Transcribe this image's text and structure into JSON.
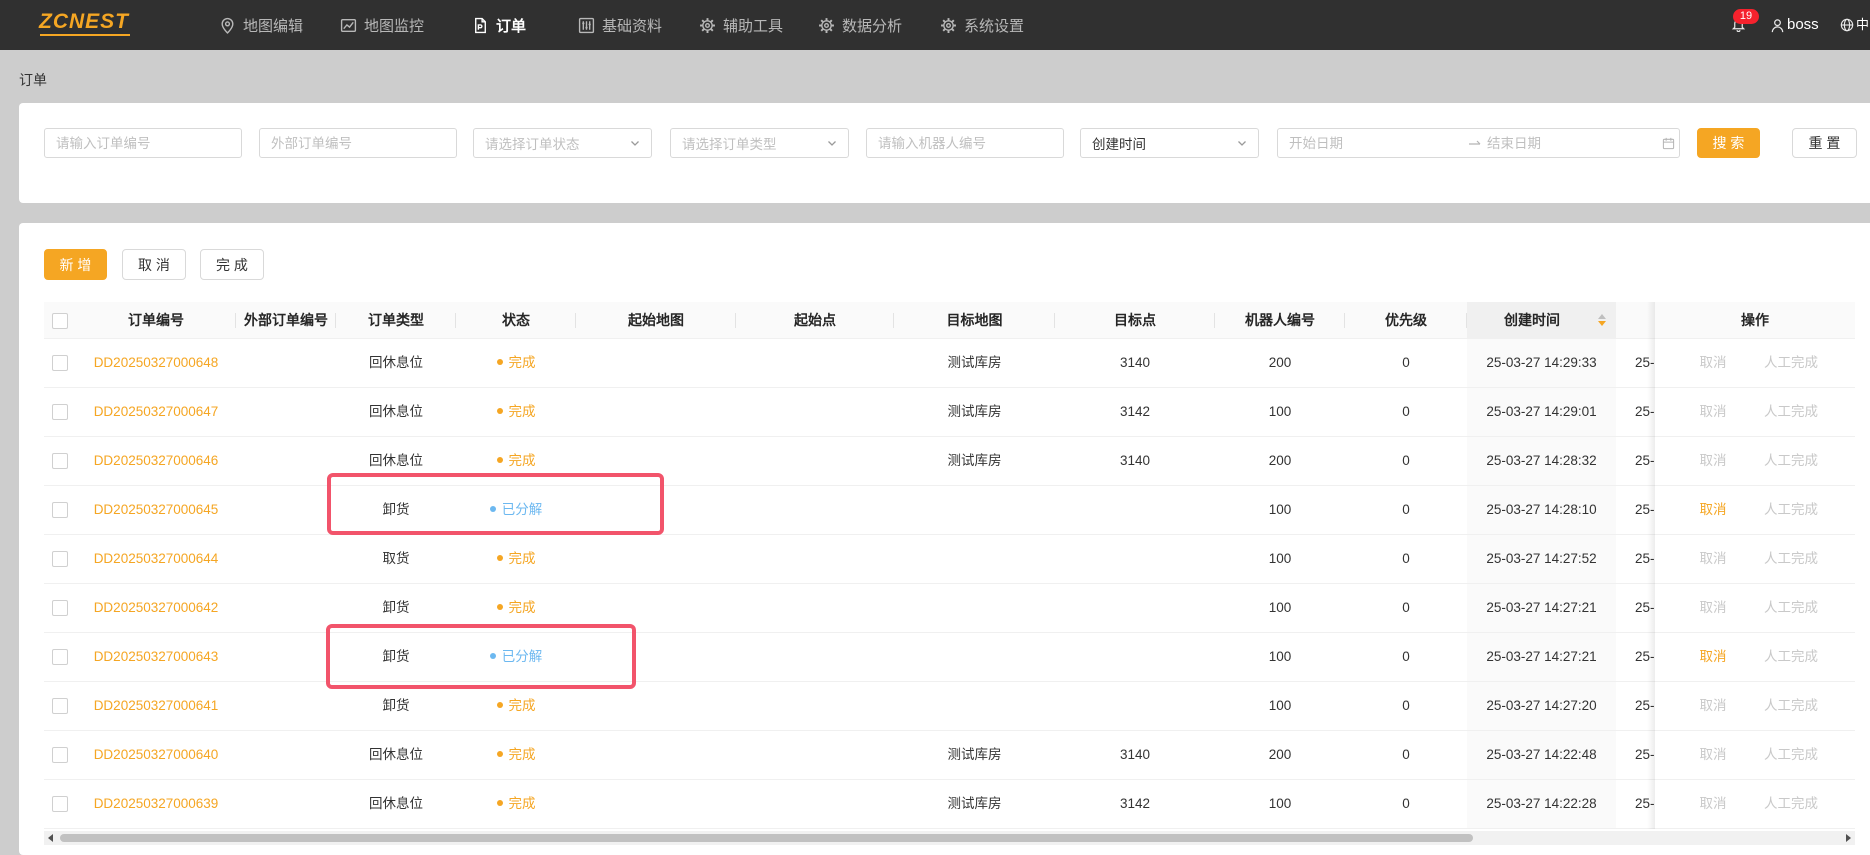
{
  "brand": {
    "logo_text": "ZCNEST",
    "accent_color": "#f5a623"
  },
  "nav": {
    "items": [
      {
        "label": "地图编辑",
        "icon": "map-pin-icon"
      },
      {
        "label": "地图监控",
        "icon": "chart-monitor-icon"
      },
      {
        "label": "订单",
        "icon": "document-icon",
        "active": true
      },
      {
        "label": "基础资料",
        "icon": "sliders-icon"
      },
      {
        "label": "辅助工具",
        "icon": "gear-icon"
      },
      {
        "label": "数据分析",
        "icon": "gear-icon"
      },
      {
        "label": "系统设置",
        "icon": "gear-icon"
      }
    ],
    "notification_count": "19",
    "user_name": "boss",
    "language": "中"
  },
  "breadcrumb": "订单",
  "filters": {
    "order_no_placeholder": "请输入订单编号",
    "external_no_placeholder": "外部订单编号",
    "status_placeholder": "请选择订单状态",
    "type_placeholder": "请选择订单类型",
    "robot_placeholder": "请输入机器人编号",
    "time_field_value": "创建时间",
    "start_date_placeholder": "开始日期",
    "end_date_placeholder": "结束日期",
    "search_label": "搜 索",
    "reset_label": "重 置"
  },
  "toolbar": {
    "add_label": "新 增",
    "cancel_label": "取 消",
    "complete_label": "完 成"
  },
  "table": {
    "headers": {
      "order_no": "订单编号",
      "external_no": "外部订单编号",
      "type": "订单类型",
      "status": "状态",
      "start_map": "起始地图",
      "start_point": "起始点",
      "target_map": "目标地图",
      "target_point": "目标点",
      "robot_no": "机器人编号",
      "priority": "优先级",
      "created_at": "创建时间",
      "ops": "操作"
    },
    "status_colors": {
      "完成": "#f5a623",
      "已分解": "#6cb8f0"
    },
    "actions": {
      "cancel": "取消",
      "manual_complete": "人工完成"
    },
    "rows": [
      {
        "order_no": "DD20250327000648",
        "type": "回休息位",
        "status": "完成",
        "target_map": "测试库房",
        "target_point": "3140",
        "robot_no": "200",
        "priority": "0",
        "created_at": "25-03-27 14:29:33",
        "next_col": "25-",
        "cancel_enabled": false
      },
      {
        "order_no": "DD20250327000647",
        "type": "回休息位",
        "status": "完成",
        "target_map": "测试库房",
        "target_point": "3142",
        "robot_no": "100",
        "priority": "0",
        "created_at": "25-03-27 14:29:01",
        "next_col": "25-",
        "cancel_enabled": false
      },
      {
        "order_no": "DD20250327000646",
        "type": "回休息位",
        "status": "完成",
        "target_map": "测试库房",
        "target_point": "3140",
        "robot_no": "200",
        "priority": "0",
        "created_at": "25-03-27 14:28:32",
        "next_col": "25-",
        "cancel_enabled": false
      },
      {
        "order_no": "DD20250327000645",
        "type": "卸货",
        "status": "已分解",
        "robot_no": "100",
        "priority": "0",
        "created_at": "25-03-27 14:28:10",
        "next_col": "25-",
        "cancel_enabled": true
      },
      {
        "order_no": "DD20250327000644",
        "type": "取货",
        "status": "完成",
        "robot_no": "100",
        "priority": "0",
        "created_at": "25-03-27 14:27:52",
        "next_col": "25-",
        "cancel_enabled": false
      },
      {
        "order_no": "DD20250327000642",
        "type": "卸货",
        "status": "完成",
        "robot_no": "100",
        "priority": "0",
        "created_at": "25-03-27 14:27:21",
        "next_col": "25-",
        "cancel_enabled": false
      },
      {
        "order_no": "DD20250327000643",
        "type": "卸货",
        "status": "已分解",
        "robot_no": "100",
        "priority": "0",
        "created_at": "25-03-27 14:27:21",
        "next_col": "25-",
        "cancel_enabled": true
      },
      {
        "order_no": "DD20250327000641",
        "type": "卸货",
        "status": "完成",
        "robot_no": "100",
        "priority": "0",
        "created_at": "25-03-27 14:27:20",
        "next_col": "25-",
        "cancel_enabled": false
      },
      {
        "order_no": "DD20250327000640",
        "type": "回休息位",
        "status": "完成",
        "target_map": "测试库房",
        "target_point": "3140",
        "robot_no": "200",
        "priority": "0",
        "created_at": "25-03-27 14:22:48",
        "next_col": "25-",
        "cancel_enabled": false
      },
      {
        "order_no": "DD20250327000639",
        "type": "回休息位",
        "status": "完成",
        "target_map": "测试库房",
        "target_point": "3142",
        "robot_no": "100",
        "priority": "0",
        "created_at": "25-03-27 14:22:28",
        "next_col": "25-",
        "cancel_enabled": false
      }
    ]
  },
  "annotations": {
    "highlight_color": "#f2546b"
  },
  "colors": {
    "nav_background": "#303030",
    "page_background": "#cdcdcd",
    "disabled_action": "#c9c9c9"
  }
}
